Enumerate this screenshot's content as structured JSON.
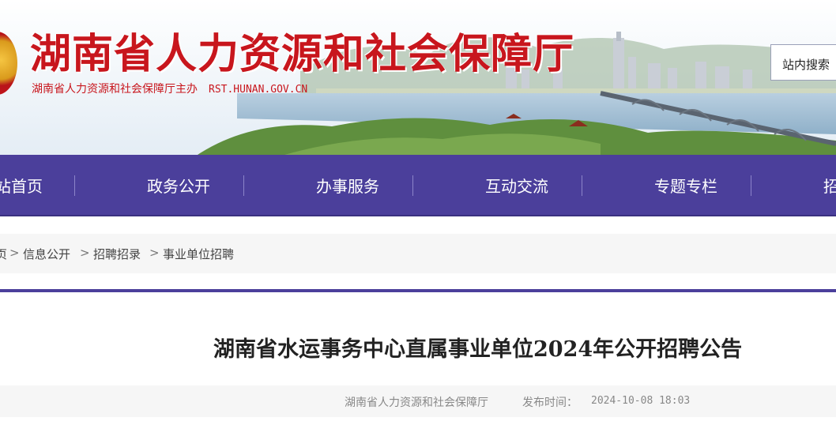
{
  "header": {
    "site_title": "湖南省人力资源和社会保障厅",
    "subtitle": "湖南省人力资源和社会保障厅主办",
    "domain": "RST.HUNAN.GOV.CN",
    "search_label": "站内搜索"
  },
  "nav": {
    "items": [
      {
        "label": "站首页"
      },
      {
        "label": "政务公开"
      },
      {
        "label": "办事服务"
      },
      {
        "label": "互动交流"
      },
      {
        "label": "专题专栏"
      },
      {
        "label": "招"
      }
    ]
  },
  "breadcrumb": {
    "items": [
      "页",
      "信息公开",
      "招聘招录",
      "事业单位招聘"
    ],
    "separator": ">"
  },
  "article": {
    "title": "湖南省水运事务中心直属事业单位2024年公开招聘公告",
    "source": "湖南省人力资源和社会保障厅",
    "date_label": "发布时间：",
    "date": "2024-10-08 18:03"
  },
  "colors": {
    "nav_bg": "#4b3f9b",
    "title_red": "#c8161d"
  }
}
